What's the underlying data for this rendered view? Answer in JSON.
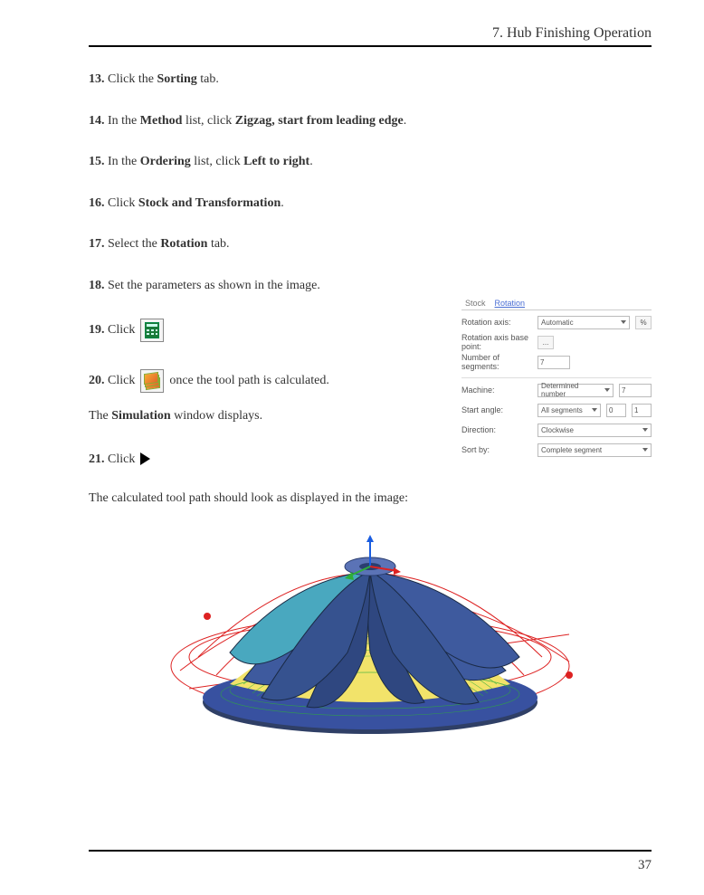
{
  "header": {
    "title": "7. Hub Finishing Operation"
  },
  "steps": {
    "s13": {
      "num": "13.",
      "a": "Click the ",
      "b": "Sorting",
      "c": " tab."
    },
    "s14": {
      "num": "14.",
      "a": "In the ",
      "b": "Method",
      "c": " list, click ",
      "d": "Zigzag, start from leading edge",
      "e": "."
    },
    "s15": {
      "num": "15.",
      "a": "In the ",
      "b": "Ordering",
      "c": " list, click ",
      "d": "Left to right",
      "e": "."
    },
    "s16": {
      "num": "16.",
      "a": "Click ",
      "b": "Stock and Transformation",
      "c": "."
    },
    "s17": {
      "num": "17.",
      "a": "Select the ",
      "b": "Rotation",
      "c": " tab."
    },
    "s18": {
      "num": "18.",
      "text": "Set the parameters as shown in the image."
    },
    "s19": {
      "num": "19.",
      "text": "Click"
    },
    "s20": {
      "num": "20.",
      "a": "Click",
      "b": "once the tool path is calculated."
    },
    "s20r": {
      "a": "The ",
      "b": "Simulation",
      "c": " window displays."
    },
    "s21": {
      "num": "21.",
      "text": "Click"
    },
    "caption": "The calculated tool path should look as displayed in the image:"
  },
  "panel": {
    "tabs": {
      "stock": "Stock",
      "rotation": "Rotation"
    },
    "rows": {
      "axis": {
        "label": "Rotation axis:",
        "value": "Automatic"
      },
      "base": {
        "label": "Rotation axis base point:",
        "value": "..."
      },
      "nseg": {
        "label": "Number of segments:",
        "value": "7"
      },
      "mach": {
        "label": "Machine:",
        "value": "Determined number",
        "extra": "7"
      },
      "start": {
        "label": "Start angle:",
        "value": "All segments",
        "extra1": "0",
        "extra2": "1"
      },
      "dir": {
        "label": "Direction:",
        "value": "Clockwise"
      },
      "sort": {
        "label": "Sort by:",
        "value": "Complete segment"
      }
    }
  },
  "pageNumber": "37"
}
